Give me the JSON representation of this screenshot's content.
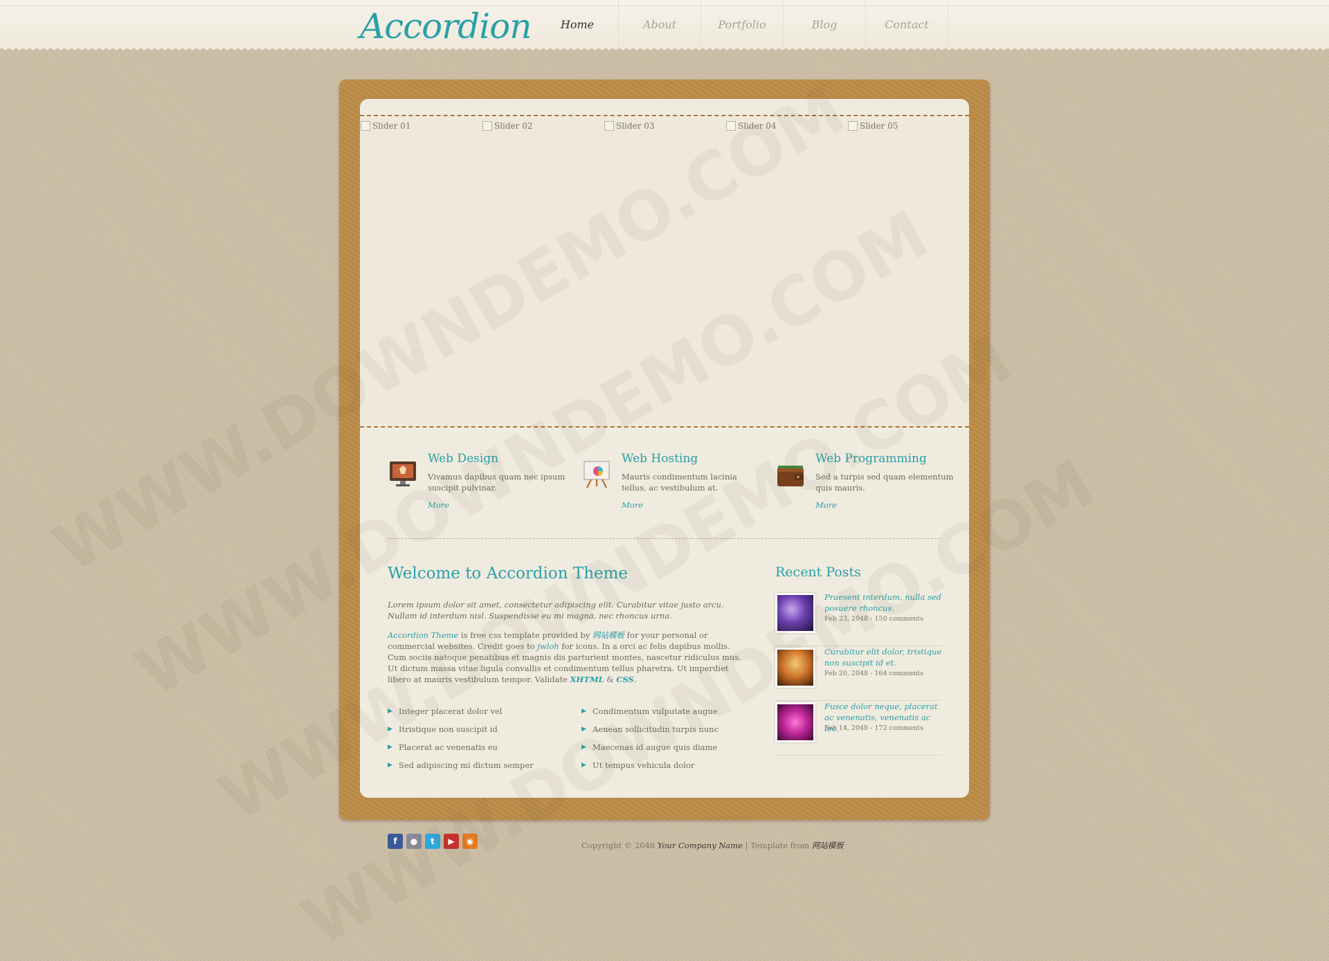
{
  "header": {
    "logo": "Accordion",
    "nav": [
      "Home",
      "About",
      "Portfolio",
      "Blog",
      "Contact"
    ],
    "active": "Home"
  },
  "slider": {
    "slides": [
      "Slider 01",
      "Slider 02",
      "Slider 03",
      "Slider 04",
      "Slider 05"
    ]
  },
  "services": [
    {
      "title": "Web Design",
      "text": "Vivamus dapibus quam nec ipsum suscipit pulvinar.",
      "more": "More",
      "icon": "monitor-icon"
    },
    {
      "title": "Web Hosting",
      "text": "Mauris condimentum lacinia tellus, ac vestibulum at.",
      "more": "More",
      "icon": "easel-icon"
    },
    {
      "title": "Web Programming",
      "text": "Sed a turpis sed quam elementum quis mauris.",
      "more": "More",
      "icon": "wallet-icon"
    }
  ],
  "welcome": {
    "title": "Welcome to Accordion Theme",
    "intro": "Lorem ipsum dolor sit amet, consectetur adipiscing elit. Curabitur vitae justo arcu. Nullam id interdum nisl. Suspendisse eu mi magna, nec rhoncus urna.",
    "link_theme": "Accordion Theme",
    "text_1": " is free css template provided by ",
    "link_site": "网站模板",
    "text_2": " for your personal or commercial websites. Credit goes to ",
    "link_icons": "jwloh",
    "text_3": " for icons. In a orci ac felis dapibus mollis. Cum sociis natoque penatibus et magnis dis parturient montes, nascetur ridiculus mus. Ut dictum massa vitae ligula convallis et condimentum tellus pharetra. Ut imperdiet libero at mauris vestibulum tempor. Validate ",
    "link_xhtml": "XHTML",
    "text_4": " & ",
    "link_css": "CSS",
    "text_5": ".",
    "list_left": [
      "Integer placerat dolor vel",
      "Itristique non suscipit id",
      "Placerat ac venenatis eu",
      "Sed adipiscing mi dictum semper"
    ],
    "list_right": [
      "Condimentum vulputate augue",
      "Aenean sollicitudin turpis nunc",
      "Maecenas id augue quis diame",
      "Ut tempus vehicula dolor"
    ]
  },
  "recent": {
    "title": "Recent Posts",
    "posts": [
      {
        "title": "Praesent interdum, nulla sed posuere rhoncus.",
        "meta": "Feb 23, 2048 - 150 comments",
        "color": "#6b3fb0"
      },
      {
        "title": "Curabitur elit dolor, tristique non suscipit id et.",
        "meta": "Feb 20, 2048 - 164 comments",
        "color": "#d2762a"
      },
      {
        "title": "Fusce dolor neque, placerat ac venenatis, venenatis ac leo.",
        "meta": "Feb 14, 2048 - 172 comments",
        "color": "#c0279a"
      }
    ]
  },
  "footer": {
    "copyright_prefix": "Copyright © 2048 ",
    "company": "Your Company Name",
    "sep": " | Template from ",
    "template_from": "网站模板",
    "social": [
      {
        "name": "facebook-icon",
        "glyph": "f",
        "color": "#3b5998"
      },
      {
        "name": "flickr-icon",
        "glyph": "●",
        "color": "#8a8a9a"
      },
      {
        "name": "twitter-icon",
        "glyph": "t",
        "color": "#2fa8dd"
      },
      {
        "name": "youtube-icon",
        "glyph": "▶",
        "color": "#c9302c"
      },
      {
        "name": "rss-icon",
        "glyph": "◉",
        "color": "#e8791f"
      }
    ]
  },
  "watermark": "WWW.DOWNDEMO.COM"
}
